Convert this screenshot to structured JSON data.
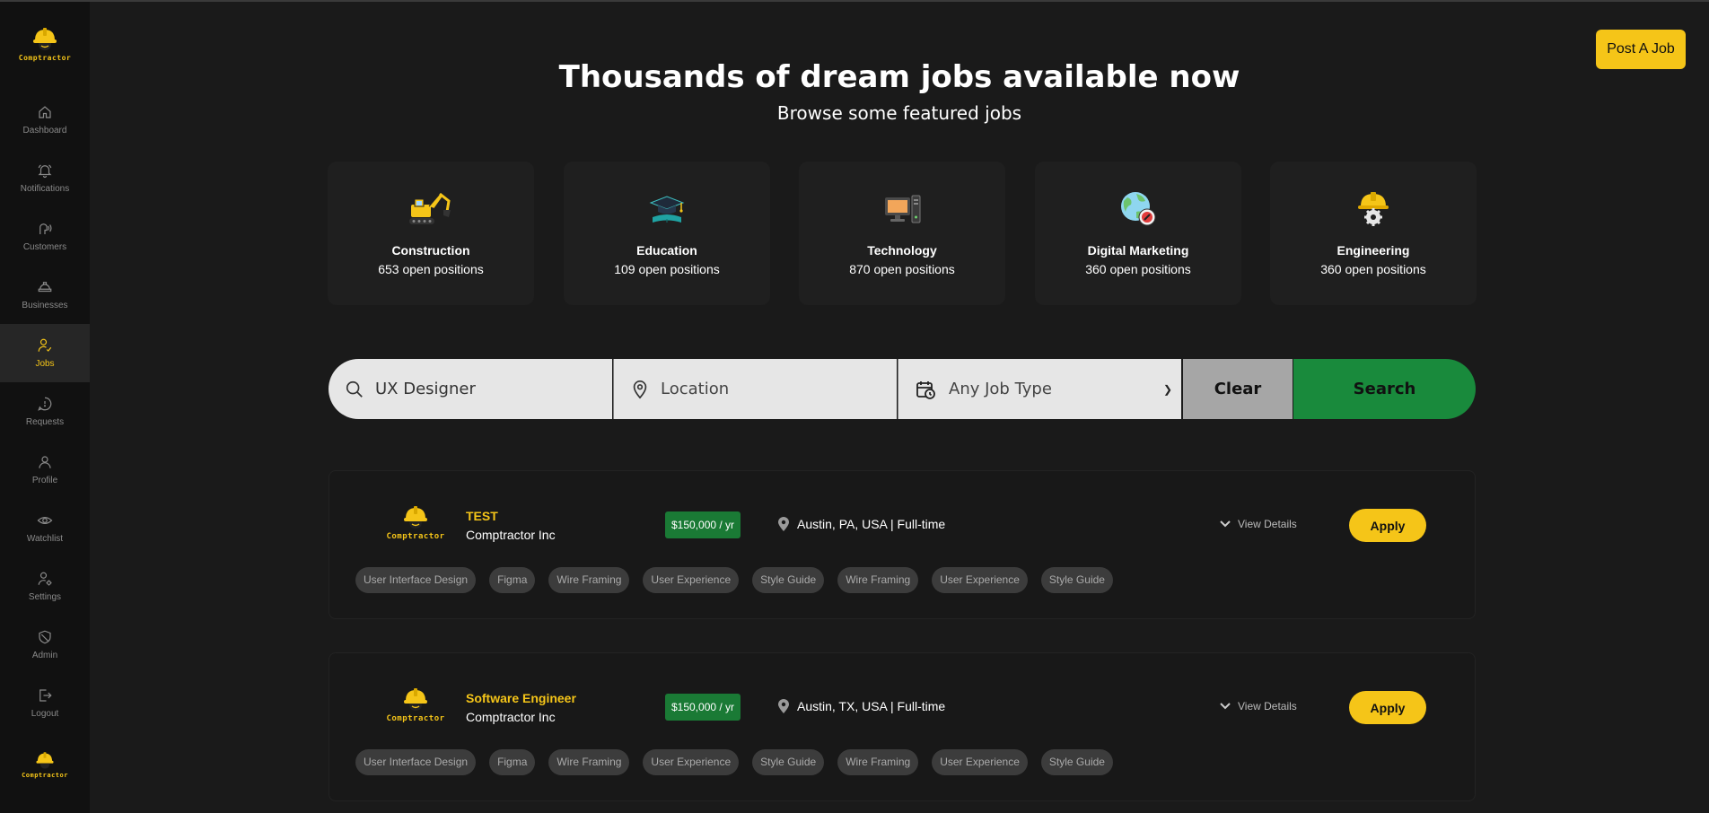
{
  "sidebar": {
    "logo_text": "Comptractor",
    "items": [
      {
        "label": "Dashboard",
        "icon": "home-icon"
      },
      {
        "label": "Notifications",
        "icon": "bell-icon"
      },
      {
        "label": "Customers",
        "icon": "customers-icon"
      },
      {
        "label": "Businesses",
        "icon": "hardhat-icon"
      },
      {
        "label": "Jobs",
        "icon": "user-check-icon",
        "active": true
      },
      {
        "label": "Requests",
        "icon": "chat-icon"
      },
      {
        "label": "Profile",
        "icon": "user-icon"
      },
      {
        "label": "Watchlist",
        "icon": "eye-icon"
      },
      {
        "label": "Settings",
        "icon": "user-settings-icon"
      },
      {
        "label": "Admin",
        "icon": "shield-icon"
      },
      {
        "label": "Logout",
        "icon": "logout-icon"
      }
    ]
  },
  "header": {
    "post_job_label": "Post A Job",
    "title": "Thousands of dream jobs available now",
    "subtitle": "Browse some featured jobs"
  },
  "categories": [
    {
      "name": "Construction",
      "count": "653 open positions",
      "icon": "excavator-icon"
    },
    {
      "name": "Education",
      "count": "109 open positions",
      "icon": "graduation-cap-icon"
    },
    {
      "name": "Technology",
      "count": "870 open positions",
      "icon": "computer-icon"
    },
    {
      "name": "Digital Marketing",
      "count": "360 open positions",
      "icon": "globe-marketing-icon"
    },
    {
      "name": "Engineering",
      "count": "360 open positions",
      "icon": "engineering-hardhat-icon"
    }
  ],
  "search": {
    "keyword_value": "UX Designer",
    "location_placeholder": "Location",
    "job_type_selected": "Any Job Type",
    "clear_label": "Clear",
    "search_label": "Search"
  },
  "jobs": [
    {
      "logo_text": "Comptractor",
      "title": "TEST",
      "company": "Comptractor Inc",
      "salary": "$150,000 / yr",
      "location": "Austin, PA, USA | Full-time",
      "details_label": "View Details",
      "apply_label": "Apply",
      "tags": [
        "User Interface Design",
        "Figma",
        "Wire Framing",
        "User Experience",
        "Style Guide",
        "Wire Framing",
        "User Experience",
        "Style Guide"
      ]
    },
    {
      "logo_text": "Comptractor",
      "title": "Software Engineer",
      "company": "Comptractor Inc",
      "salary": "$150,000 / yr",
      "location": "Austin, TX, USA | Full-time",
      "details_label": "View Details",
      "apply_label": "Apply",
      "tags": [
        "User Interface Design",
        "Figma",
        "Wire Framing",
        "User Experience",
        "Style Guide",
        "Wire Framing",
        "User Experience",
        "Style Guide"
      ]
    }
  ],
  "colors": {
    "accent": "#f5c518",
    "search_green": "#198a3c",
    "salary_green": "#1a7a35",
    "background": "#1a1a1a",
    "sidebar": "#111111"
  }
}
